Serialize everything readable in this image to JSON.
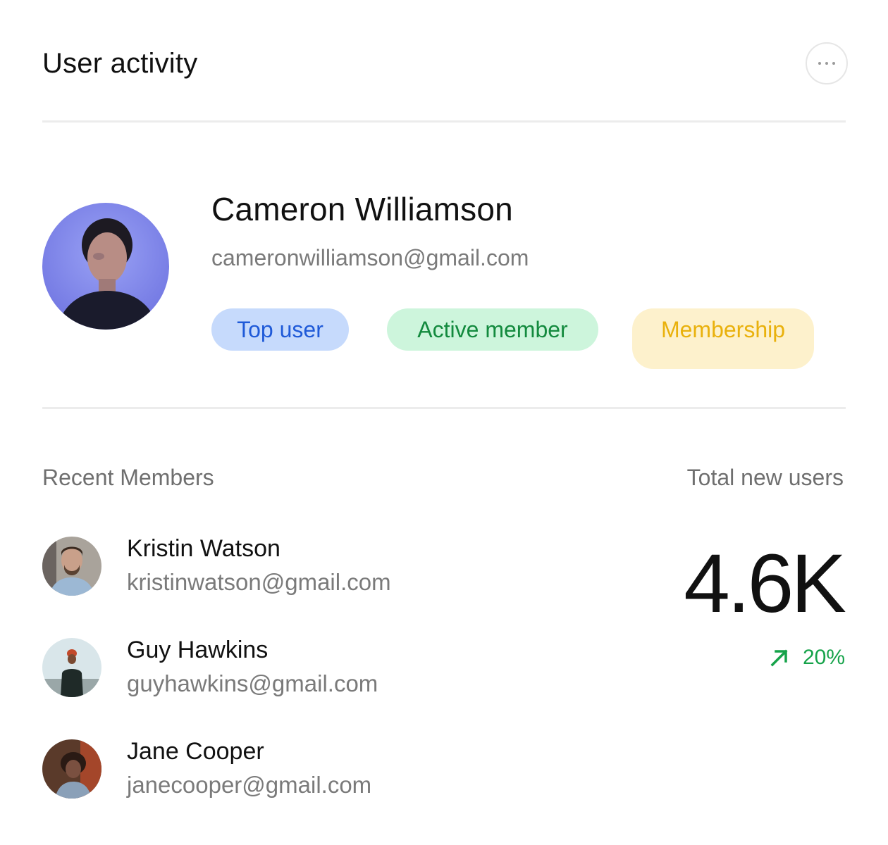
{
  "header": {
    "title": "User activity",
    "more_icon": "more-horizontal-icon"
  },
  "profile": {
    "name": "Cameron Williamson",
    "email": "cameronwilliamson@gmail.com",
    "badges": [
      {
        "label": "Top user",
        "bg": "#c6dafc",
        "color": "#1f5ad8"
      },
      {
        "label": "Active member",
        "bg": "#cdf5dc",
        "color": "#138a3e"
      },
      {
        "label": "Membership",
        "bg": "#fdf1cc",
        "color": "#e9b10c"
      }
    ]
  },
  "recent_members": {
    "label": "Recent Members",
    "items": [
      {
        "name": "Kristin Watson",
        "email": "kristinwatson@gmail.com"
      },
      {
        "name": "Guy Hawkins",
        "email": "guyhawkins@gmail.com"
      },
      {
        "name": "Jane Cooper",
        "email": "janecooper@gmail.com"
      }
    ]
  },
  "stats": {
    "label": "Total new users",
    "value": "4.6K",
    "change": "20%",
    "change_icon": "arrow-up-right-icon",
    "change_color": "#16a34a"
  }
}
